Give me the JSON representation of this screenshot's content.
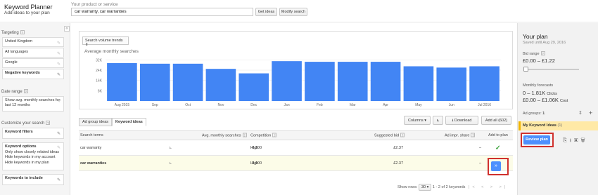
{
  "app": {
    "title": "Keyword Planner",
    "subtitle": "Add ideas to your plan"
  },
  "search": {
    "label": "Your product or service",
    "value": "car warranty, car warranties",
    "get_ideas": "Get ideas",
    "modify": "Modify search"
  },
  "sidebar": {
    "collapse_glyph": "«",
    "targeting_label": "Targeting",
    "targeting": [
      "United Kingdom",
      "All languages",
      "Google",
      "Negative keywords"
    ],
    "date_range_label": "Date range",
    "date_range_value": "Show avg. monthly searches for: last 12 months",
    "customize_label": "Customize your search",
    "keyword_filters": "Keyword filters",
    "keyword_options_title": "Keyword options",
    "keyword_options": [
      "Only show closely related ideas",
      "Hide keywords in my account",
      "Hide keywords in my plan"
    ],
    "keywords_include": "Keywords to include"
  },
  "chart": {
    "dropdown": "Search volume trends"
  },
  "chart_data": {
    "type": "bar",
    "title": "Average monthly searches",
    "categories": [
      "Aug 2015",
      "Sep",
      "Oct",
      "Nov",
      "Dec",
      "Jan",
      "Feb",
      "Mar",
      "Apr",
      "May",
      "Jun",
      "Jul 2016"
    ],
    "values": [
      29500,
      29000,
      29000,
      25000,
      21500,
      31000,
      30500,
      30500,
      30500,
      27000,
      26000,
      27000
    ],
    "yticks": [
      "32K",
      "24K",
      "16K",
      "8K"
    ],
    "ylim": [
      0,
      36000
    ],
    "color": "#4285f4"
  },
  "tabs": {
    "ad_group": "Ad group ideas",
    "keyword": "Keyword ideas"
  },
  "toolbar": {
    "columns": "Columns",
    "download": "Download",
    "add_all": "Add all (602)"
  },
  "table": {
    "headers": {
      "terms": "Search terms",
      "avg": "Avg. monthly searches",
      "competition": "Competition",
      "bid": "Suggested bid",
      "impr": "Ad impr. share",
      "add": "Add to plan"
    },
    "rows": [
      {
        "term": "car warranty",
        "avg": "8,100",
        "competition": "High",
        "bid": "£2.37",
        "impr": "–",
        "add": "✓"
      },
      {
        "term": "car warranties",
        "avg": "8,100",
        "competition": "High",
        "bid": "£2.37",
        "impr": "–",
        "add": "»"
      }
    ],
    "footer": {
      "show_rows": "Show rows:",
      "rows_count": "30",
      "range": "1 - 2 of 2 keywords"
    }
  },
  "plan": {
    "title": "Your plan",
    "saved": "Saved until Aug 29, 2016",
    "bid_label": "Bid range",
    "bid_value": "£0.00 – £1.22",
    "forecast_label": "Monthly forecasts",
    "clicks": "0 – 1.81K",
    "clicks_unit": "Clicks",
    "cost": "£0.00 – £1.06K",
    "cost_unit": "Cost",
    "ad_groups_label": "Ad groups:",
    "ad_groups_count": "1",
    "group_name": "My Keyword Ideas",
    "group_count": "(1)",
    "review": "Review plan"
  }
}
